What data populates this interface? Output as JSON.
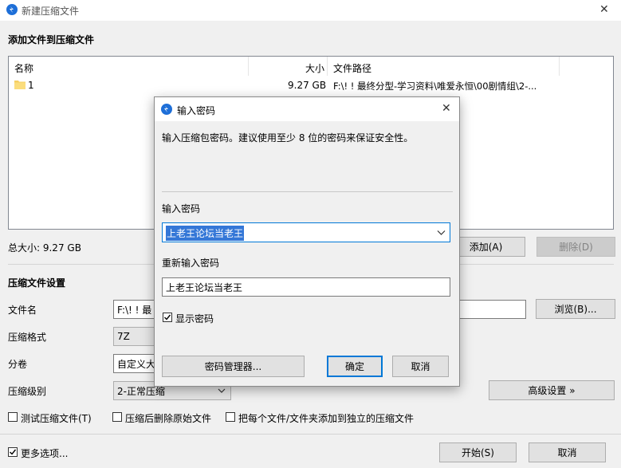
{
  "window": {
    "title": "新建压缩文件",
    "close_glyph": "✕"
  },
  "files_section": {
    "heading": "添加文件到压缩文件",
    "columns": [
      "名称",
      "大小",
      "文件路径"
    ],
    "rows": [
      {
        "name": "1",
        "size": "9.27 GB",
        "path": "F:\\! ! 最终分型-学习资料\\唯爱永恒\\00剧情组\\2-..."
      }
    ],
    "total_label": "总大小: 9.27 GB",
    "add_button": "添加(A)",
    "delete_button": "删除(D)"
  },
  "settings": {
    "heading": "压缩文件设置",
    "filename_label": "文件名",
    "filename_value": "F:\\! ! 最",
    "browse_button": "浏览(B)...",
    "format_label": "压缩格式",
    "format_value": "7Z",
    "split_label": "分卷",
    "split_value": "自定义大",
    "level_label": "压缩级别",
    "level_value": "2-正常压缩",
    "advanced_button": "高级设置 »",
    "options": [
      {
        "label": "测试压缩文件(T)",
        "checked": false
      },
      {
        "label": "压缩后删除原始文件",
        "checked": false
      },
      {
        "label": "把每个文件/文件夹添加到独立的压缩文件",
        "checked": false
      }
    ]
  },
  "footer": {
    "more_options_label": "更多选项...",
    "more_options_checked": true,
    "start_button": "开始(S)",
    "cancel_button": "取消"
  },
  "dialog": {
    "title": "输入密码",
    "close_glyph": "✕",
    "description": "输入压缩包密码。建议使用至少 8 位的密码来保证安全性。",
    "password_label": "输入密码",
    "password_value": "上老王论坛当老王",
    "confirm_label": "重新输入密码",
    "confirm_value": "上老王论坛当老王",
    "show_password_label": "显示密码",
    "show_password_checked": true,
    "manager_button": "密码管理器...",
    "ok_button": "确定",
    "cancel_button": "取消"
  },
  "colors": {
    "accent": "#1e6fd8",
    "selection": "#3477d7",
    "focus_border": "#0078d7"
  }
}
